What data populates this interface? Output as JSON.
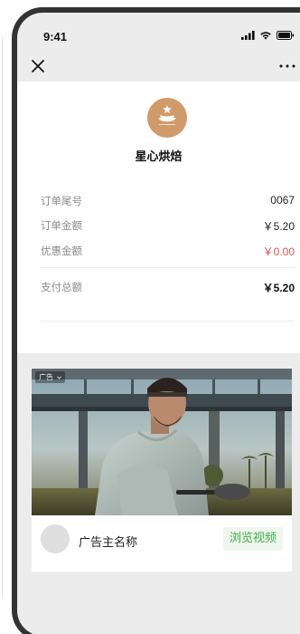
{
  "status_bar": {
    "time": "9:41"
  },
  "merchant": {
    "name": "星心烘焙"
  },
  "order": {
    "rows": [
      {
        "label": "订单尾号",
        "value": "0067"
      },
      {
        "label": "订单金额",
        "value": "￥5.20"
      },
      {
        "label": "优惠金额",
        "value": "￥0.00"
      }
    ],
    "total": {
      "label": "支付总额",
      "value": "￥5.20"
    }
  },
  "ad": {
    "tag": "广告",
    "advertiser_name": "广告主名称",
    "cta_label": "浏览视频"
  },
  "colors": {
    "phone_frame": "#333333",
    "logo": "#d19a6a",
    "discount": "#d9534f",
    "cta_text": "#3fae4a",
    "cta_bg": "#eef6ee",
    "page_gray": "#ececec"
  },
  "icons": [
    "signal-icon",
    "wifi-icon",
    "battery-icon",
    "close-icon",
    "more-icon",
    "ad-tag-chevron-icon"
  ]
}
